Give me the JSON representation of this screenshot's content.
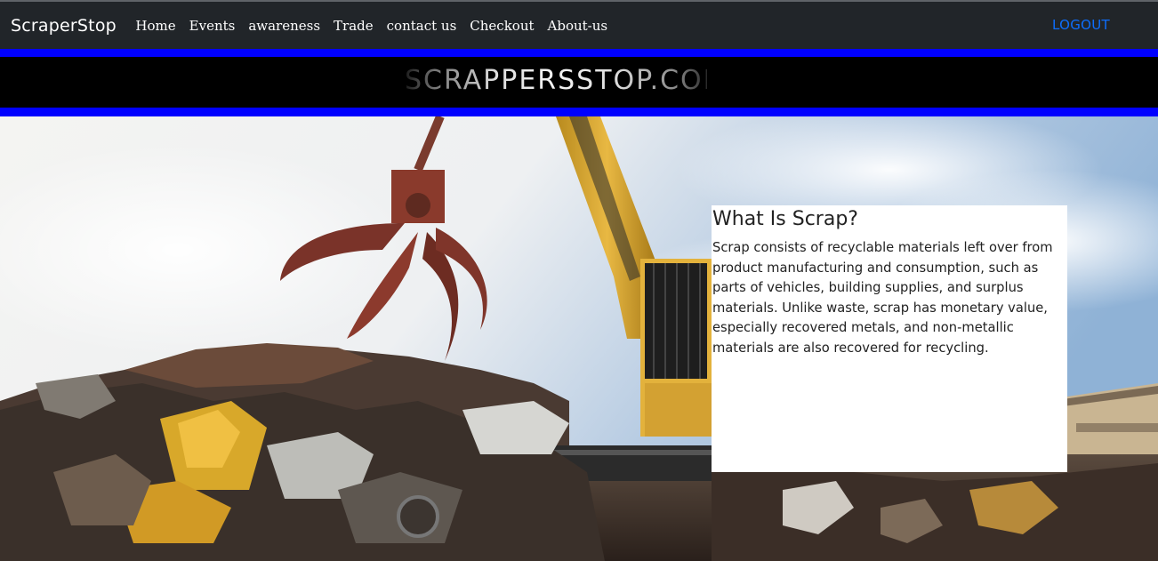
{
  "navbar": {
    "brand": "ScraperStop",
    "links": [
      "Home",
      "Events",
      "awareness",
      "Trade",
      "contact us",
      "Checkout",
      "About-us"
    ],
    "logout": "LOGOUT"
  },
  "banner": {
    "text": "SCRAPPERSSTOP.COM"
  },
  "card": {
    "title": "What Is Scrap?",
    "body": "Scrap consists of recyclable materials left over from product manufacturing and consumption, such as parts of vehicles, building supplies, and surplus materials. Unlike waste, scrap has monetary value, especially recovered metals, and non-metallic materials are also recovered for recycling."
  },
  "colors": {
    "navbar_bg": "#212529",
    "banner_border": "#0000ff",
    "logout": "#0d6efd",
    "excavator": "#e3b23c"
  }
}
